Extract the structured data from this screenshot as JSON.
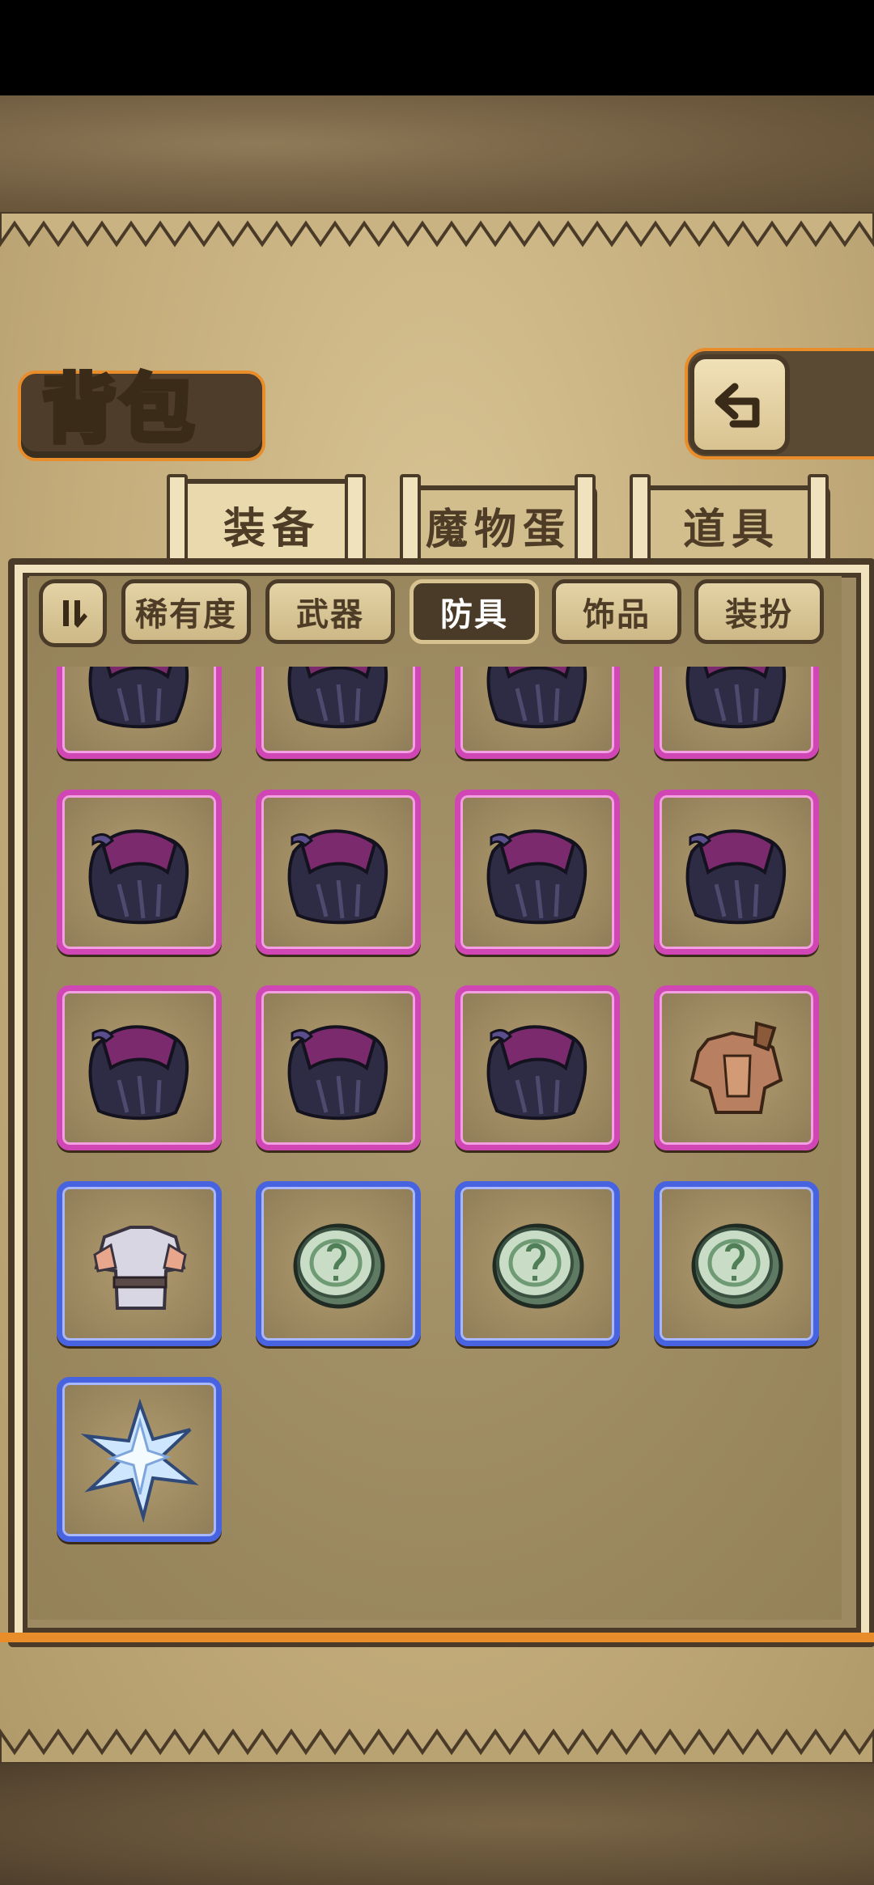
{
  "header": {
    "title": "背包"
  },
  "tabs": [
    {
      "label": "装备",
      "active": true
    },
    {
      "label": "魔物蛋",
      "active": false
    },
    {
      "label": "道具",
      "active": false
    }
  ],
  "filters": [
    {
      "label": "稀有度",
      "selected": false
    },
    {
      "label": "武器",
      "selected": false
    },
    {
      "label": "防具",
      "selected": true
    },
    {
      "label": "饰品",
      "selected": false
    },
    {
      "label": "装扮",
      "selected": false
    }
  ],
  "inventory": {
    "rows": [
      [
        "purple-cloak-icon",
        "purple-cloak-icon",
        "purple-cloak-icon",
        "purple-cloak-icon"
      ],
      [
        "purple-cloak-icon",
        "purple-cloak-icon",
        "purple-cloak-icon",
        "purple-cloak-icon"
      ],
      [
        "purple-cloak-icon",
        "purple-cloak-icon",
        "purple-cloak-icon",
        "bronze-armor-icon"
      ],
      [
        "silver-armor-icon",
        "jade-coin-icon",
        "jade-coin-icon",
        "jade-coin-icon"
      ],
      [
        "ice-crystal-icon"
      ]
    ],
    "rarity_rows": [
      "epic",
      "epic",
      "epic",
      "rare",
      "rare"
    ],
    "colors": {
      "epic": "#d046b4",
      "rare": "#4763e0",
      "accent": "#e98c2a"
    }
  }
}
